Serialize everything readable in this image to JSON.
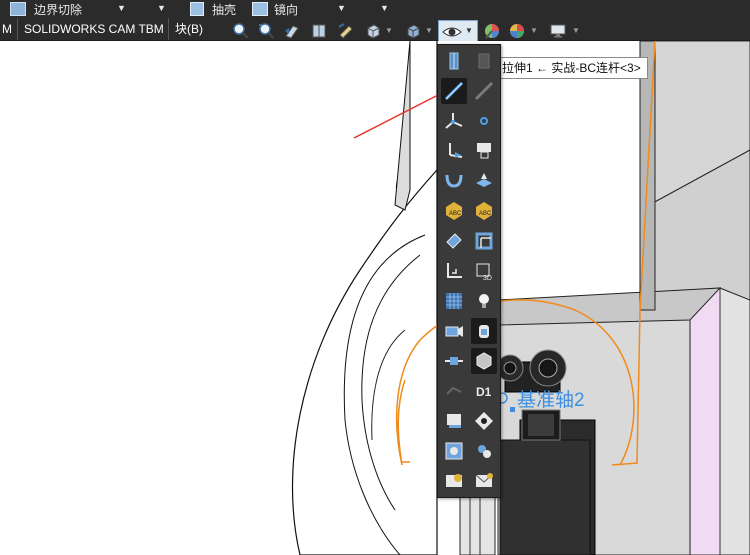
{
  "topbar": {
    "item1": "边界切除",
    "item2": "抽壳",
    "item3": "镜向"
  },
  "tabs": [
    {
      "label": "M"
    },
    {
      "label": "SOLIDWORKS CAM TBM"
    },
    {
      "label": "块(B)"
    }
  ],
  "tooltip": {
    "text": "拉伸1 ← 实战-BC连杆<3>"
  },
  "viewport": {
    "plane_label": "基准轴2"
  },
  "colors": {
    "panel": "#3a3a3a",
    "toolbar": "#2b2b2b",
    "orange_edge": "#f08a1a",
    "annotation_arrow": "#e8332a",
    "plane_blue": "#3d8fe0",
    "face_pink": "#f1dbf3",
    "face_gray": "#d9d9d9"
  },
  "flyout_icons": [
    "hide-show-bodies-icon",
    "hide-show-planes-disabled-icon",
    "view-axes-icon",
    "view-temporary-axes-icon",
    "view-origins-icon",
    "view-coordinate-systems-icon",
    "view-sketches-icon",
    "view-dimension-names-icon",
    "view-curves-icon",
    "view-planes-icon",
    "view-annotations-icon",
    "view-all-annotations-icon",
    "view-sketch-relations-icon",
    "view-weld-beads-icon",
    "view-parting-lines-icon",
    "view-3d-sketch-icon",
    "view-grid-icon",
    "view-lights-icon",
    "view-cameras-icon",
    "view-decals-icon",
    "view-routing-points-icon",
    "view-parts-icon",
    "view-selected-routing-icon",
    "view-d1-dimensions-icon",
    "view-section-display-icon",
    "view-center-of-mass-icon",
    "view-assembly-icon",
    "view-mate-icon",
    "view-annotation-link-icon",
    "view-mail-icon",
    "view-edit-link-icon",
    "view-all-types-icon"
  ]
}
